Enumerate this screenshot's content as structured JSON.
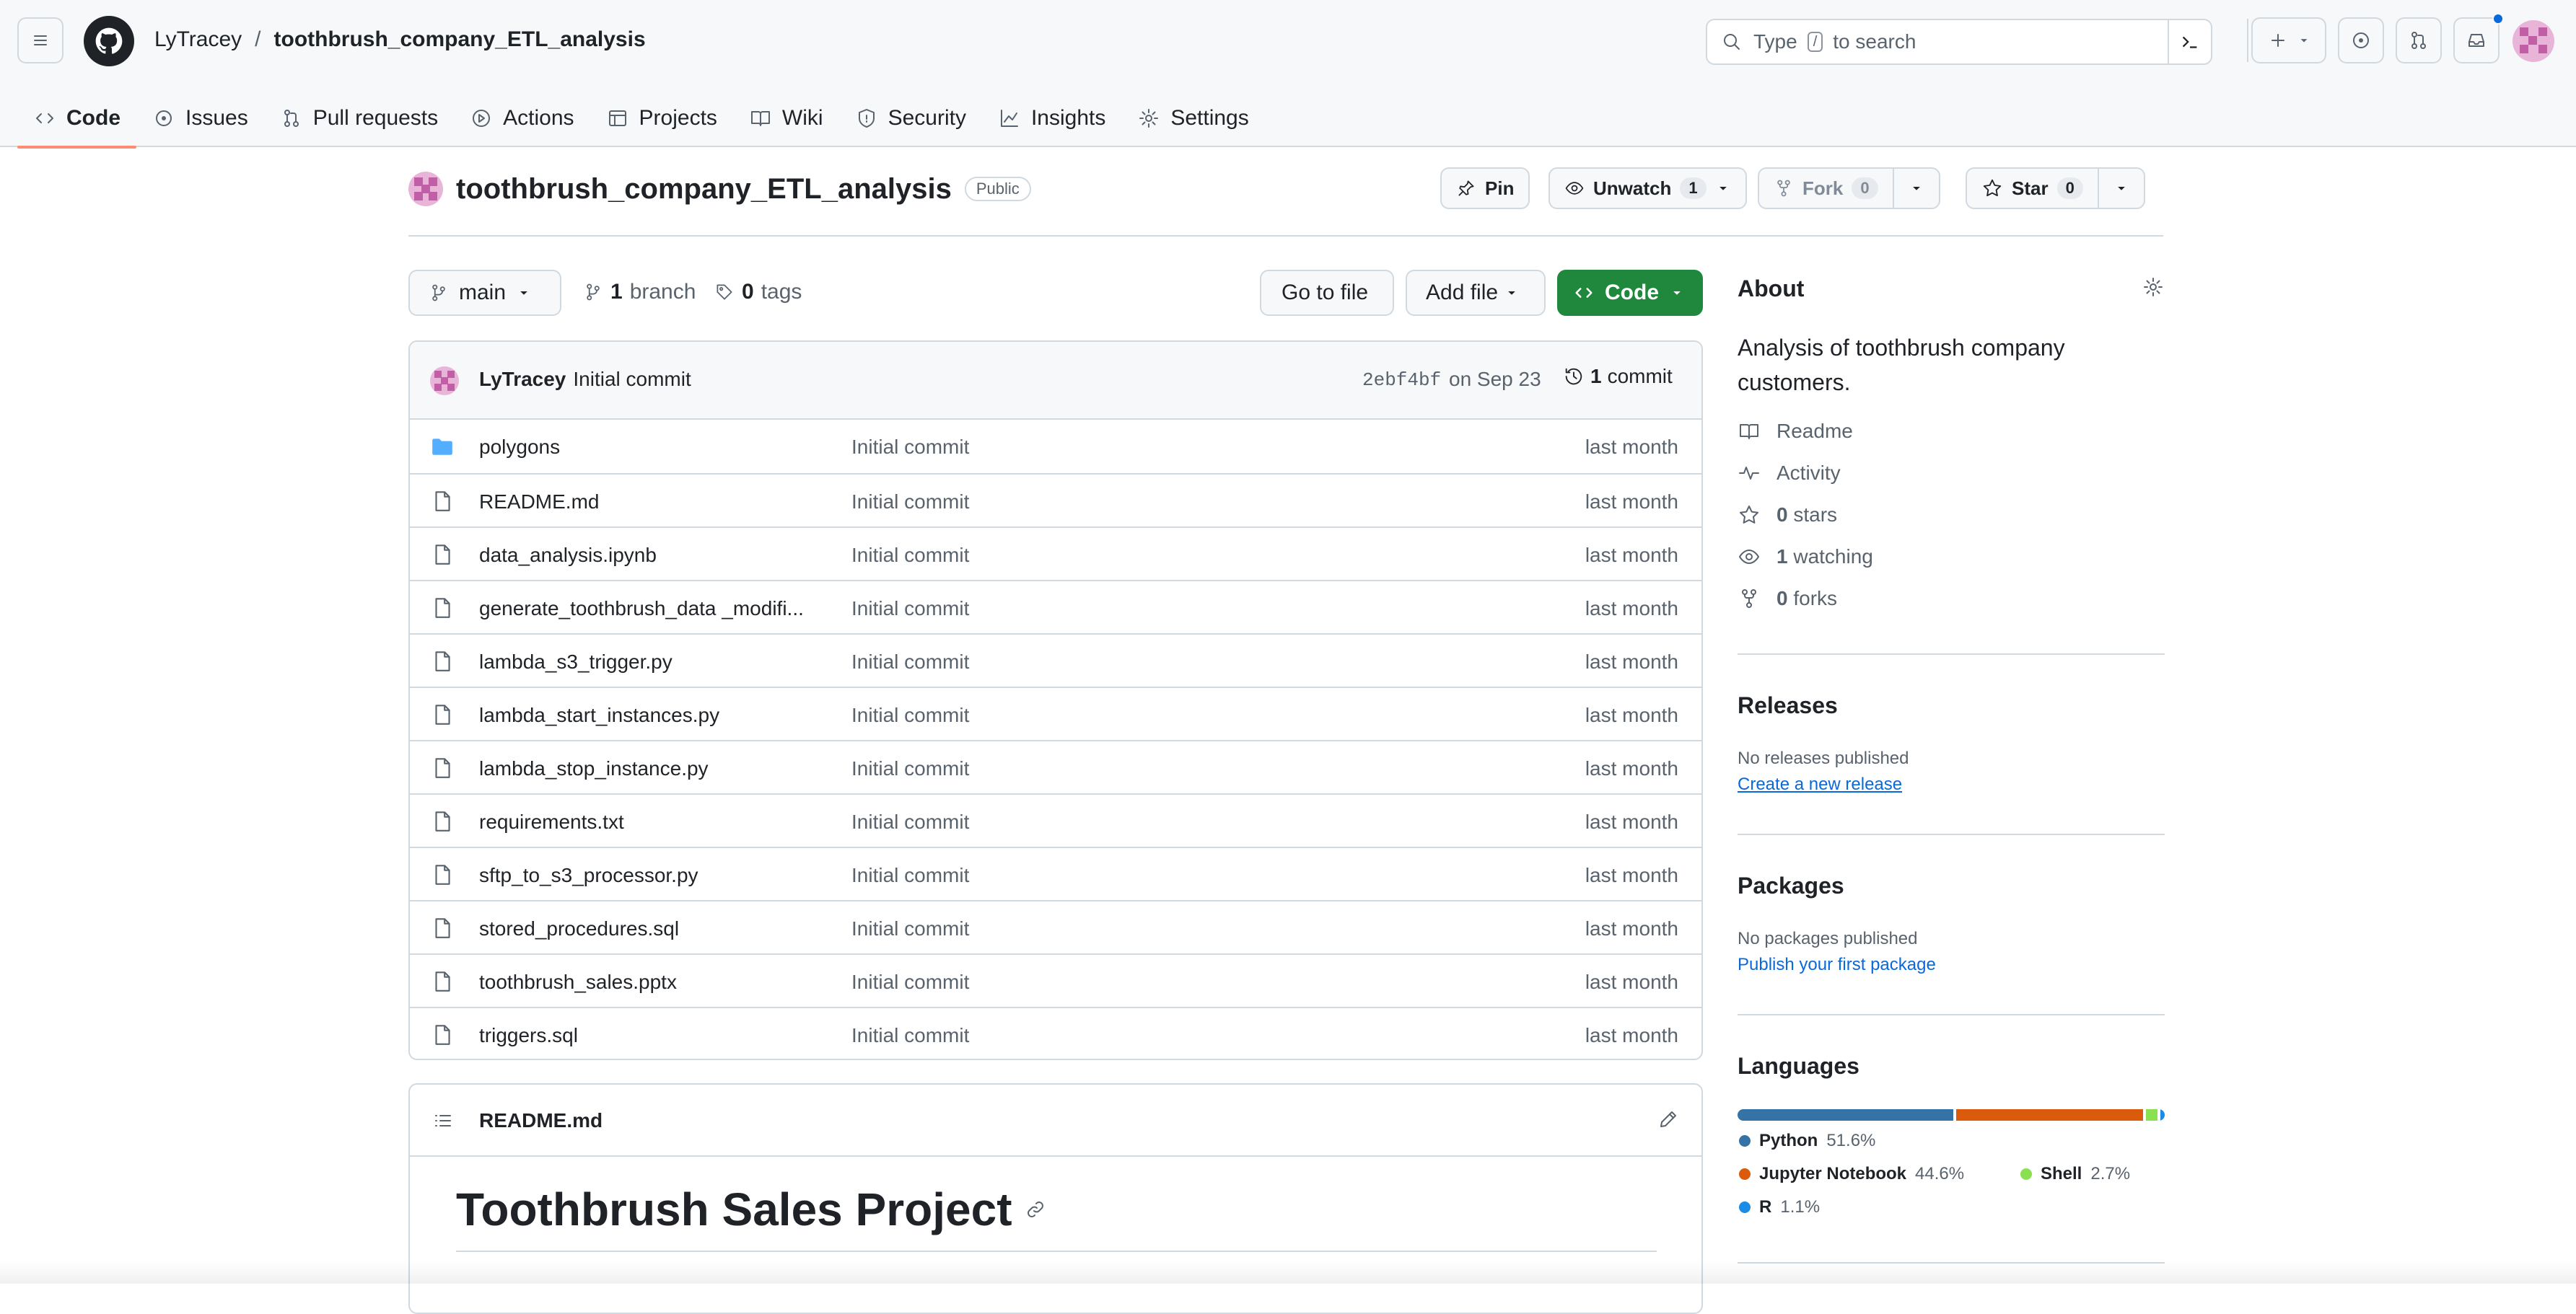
{
  "header": {
    "owner": "LyTracey",
    "separator": "/",
    "repo": "toothbrush_company_ETL_analysis",
    "search_before": "Type",
    "search_key": "/",
    "search_after": "to search"
  },
  "tabs": [
    {
      "label": "Code",
      "icon": "code-icon"
    },
    {
      "label": "Issues",
      "icon": "issue-icon"
    },
    {
      "label": "Pull requests",
      "icon": "pull-request-icon"
    },
    {
      "label": "Actions",
      "icon": "play-icon"
    },
    {
      "label": "Projects",
      "icon": "table-icon"
    },
    {
      "label": "Wiki",
      "icon": "book-icon"
    },
    {
      "label": "Security",
      "icon": "shield-icon"
    },
    {
      "label": "Insights",
      "icon": "graph-icon"
    },
    {
      "label": "Settings",
      "icon": "gear-icon"
    }
  ],
  "repo": {
    "name": "toothbrush_company_ETL_analysis",
    "visibility": "Public",
    "pin_label": "Pin",
    "unwatch_label": "Unwatch",
    "watch_count": "1",
    "fork_label": "Fork",
    "fork_count": "0",
    "star_label": "Star",
    "star_count": "0"
  },
  "controls": {
    "branch": "main",
    "branches_count": "1",
    "branches_label": "branch",
    "tags_count": "0",
    "tags_label": "tags",
    "go_to_file": "Go to file",
    "add_file": "Add file",
    "code": "Code"
  },
  "commit": {
    "author": "LyTracey",
    "message": "Initial commit",
    "sha": "2ebf4bf",
    "date": "on Sep 23",
    "count": "1",
    "count_label": "commit"
  },
  "files": [
    {
      "name": "polygons",
      "type": "folder",
      "commit": "Initial commit",
      "time": "last month"
    },
    {
      "name": "README.md",
      "type": "file",
      "commit": "Initial commit",
      "time": "last month"
    },
    {
      "name": "data_analysis.ipynb",
      "type": "file",
      "commit": "Initial commit",
      "time": "last month"
    },
    {
      "name": "generate_toothbrush_data _modifi...",
      "type": "file",
      "commit": "Initial commit",
      "time": "last month"
    },
    {
      "name": "lambda_s3_trigger.py",
      "type": "file",
      "commit": "Initial commit",
      "time": "last month"
    },
    {
      "name": "lambda_start_instances.py",
      "type": "file",
      "commit": "Initial commit",
      "time": "last month"
    },
    {
      "name": "lambda_stop_instance.py",
      "type": "file",
      "commit": "Initial commit",
      "time": "last month"
    },
    {
      "name": "requirements.txt",
      "type": "file",
      "commit": "Initial commit",
      "time": "last month"
    },
    {
      "name": "sftp_to_s3_processor.py",
      "type": "file",
      "commit": "Initial commit",
      "time": "last month"
    },
    {
      "name": "stored_procedures.sql",
      "type": "file",
      "commit": "Initial commit",
      "time": "last month"
    },
    {
      "name": "toothbrush_sales.pptx",
      "type": "file",
      "commit": "Initial commit",
      "time": "last month"
    },
    {
      "name": "triggers.sql",
      "type": "file",
      "commit": "Initial commit",
      "time": "last month"
    }
  ],
  "readme": {
    "file": "README.md",
    "heading": "Toothbrush Sales Project"
  },
  "about": {
    "title": "About",
    "description": "Analysis of toothbrush company customers.",
    "readme": "Readme",
    "activity": "Activity",
    "stars_count": "0",
    "stars_label": "stars",
    "watching_count": "1",
    "watching_label": "watching",
    "forks_count": "0",
    "forks_label": "forks"
  },
  "releases": {
    "title": "Releases",
    "none": "No releases published",
    "link": "Create a new release"
  },
  "packages": {
    "title": "Packages",
    "none": "No packages published",
    "link": "Publish your first package"
  },
  "languages": {
    "title": "Languages",
    "items": [
      {
        "name": "Python",
        "percent": "51.6%",
        "value": 51.6,
        "color": "#3572A5"
      },
      {
        "name": "Jupyter Notebook",
        "percent": "44.6%",
        "value": 44.6,
        "color": "#DA5B0B"
      },
      {
        "name": "Shell",
        "percent": "2.7%",
        "value": 2.7,
        "color": "#89e051"
      },
      {
        "name": "R",
        "percent": "1.1%",
        "value": 1.1,
        "color": "#198CE7"
      }
    ]
  }
}
